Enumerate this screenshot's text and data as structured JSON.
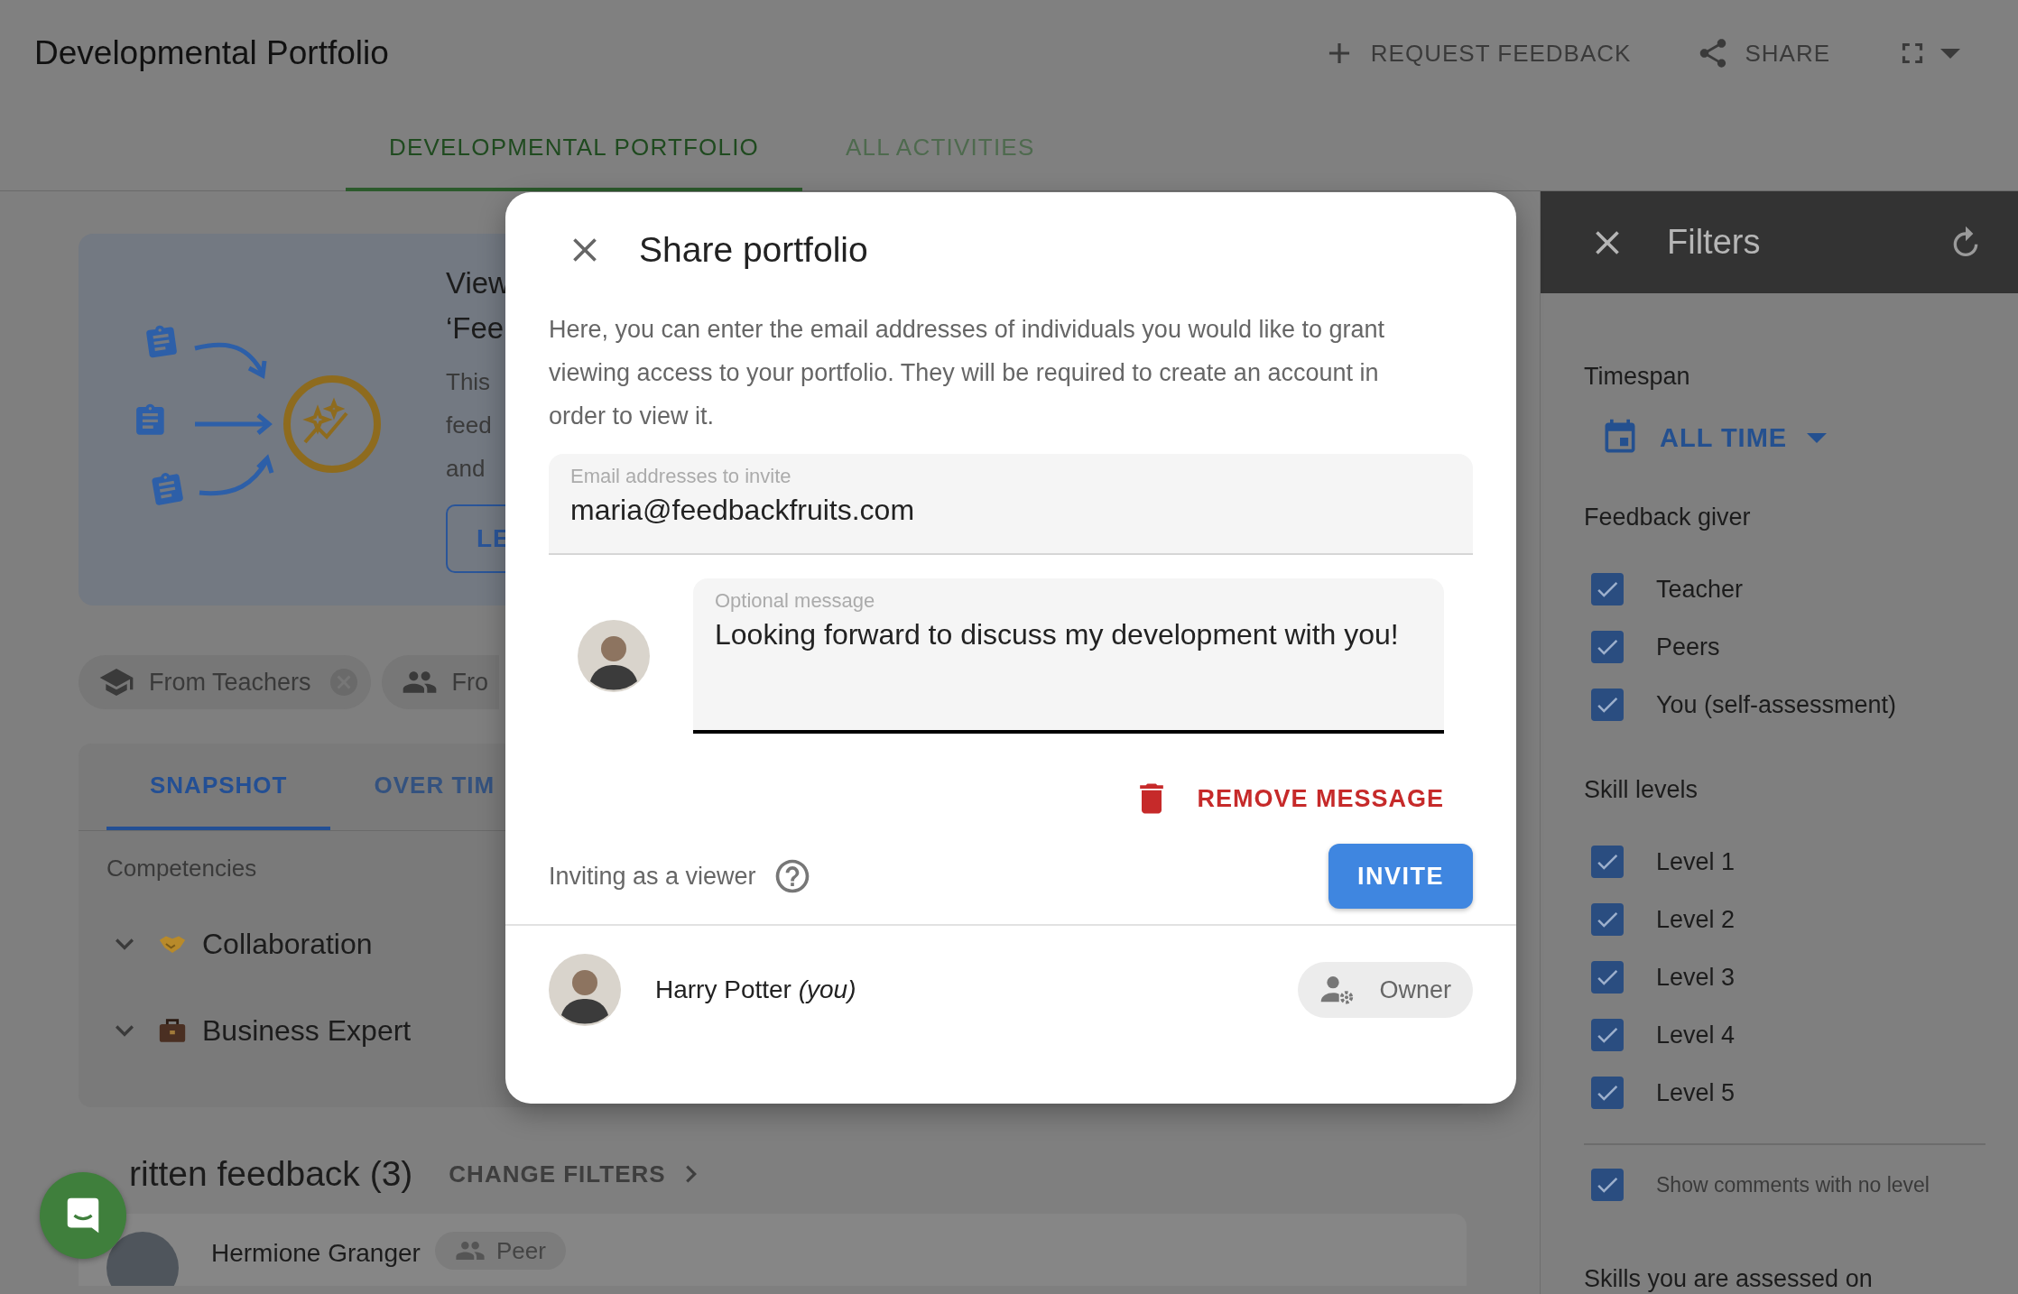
{
  "app_bar": {
    "title": "Developmental Portfolio",
    "actions": [
      {
        "kind": "add",
        "label": "REQUEST FEEDBACK"
      },
      {
        "kind": "share",
        "label": "SHARE"
      },
      {
        "kind": "fullscreen"
      }
    ]
  },
  "tabs": [
    {
      "label": "DEVELOPMENTAL PORTFOLIO",
      "selected": true
    },
    {
      "label": "ALL ACTIVITIES",
      "selected": false
    }
  ],
  "intro_card": {
    "heading_lines": [
      "View",
      "‘Fee"
    ],
    "body_lines": [
      "This",
      "feed",
      "and"
    ],
    "button": "LE"
  },
  "filter_chips": [
    {
      "kind": "teachers",
      "label": "From Teachers",
      "removable": true
    },
    {
      "kind": "people",
      "label": "Fro",
      "removable": false
    }
  ],
  "snapshot": {
    "tabs": [
      {
        "label": "SNAPSHOT",
        "selected": true
      },
      {
        "label": "OVER TIM",
        "selected": false
      }
    ],
    "heading": "Competencies",
    "rows": [
      {
        "kind": "handshake",
        "label": "Collaboration",
        "expanded": false
      },
      {
        "kind": "briefcase",
        "label": "Business Expert",
        "expanded": false
      }
    ]
  },
  "written_feedback": {
    "title": "ritten feedback (3)",
    "action": "CHANGE FILTERS",
    "items": [
      {
        "name": "Hermione Granger",
        "role": "Peer"
      }
    ]
  },
  "dialog": {
    "title": "Share portfolio",
    "description": "Here, you can enter the email addresses of individuals you would like to grant viewing access to your portfolio. They will be required to create an account in order to view it.",
    "email_field": {
      "label": "Email addresses to invite",
      "value": "maria@feedbackfruits.com"
    },
    "message_field": {
      "label": "Optional message",
      "value": "Looking forward to discuss my development with you!"
    },
    "remove_button": "REMOVE MESSAGE",
    "role_note": "Inviting as a viewer",
    "invite_button": "INVITE",
    "members": [
      {
        "name": "Harry Potter *(you)*",
        "role": "Owner"
      }
    ]
  },
  "filters": {
    "title": "Filters",
    "sections": [
      {
        "kind": "dropdown",
        "heading": "Timespan",
        "value": "ALL TIME"
      },
      {
        "kind": "checkboxes",
        "heading": "Feedback giver",
        "options": [
          {
            "label": "Teacher",
            "checked": true
          },
          {
            "label": "Peers",
            "checked": true
          },
          {
            "label": "You (self-assessment)",
            "checked": true
          }
        ]
      },
      {
        "kind": "checkboxes",
        "heading": "Skill levels",
        "options": [
          {
            "label": "Level 1",
            "checked": true
          },
          {
            "label": "Level 2",
            "checked": true
          },
          {
            "label": "Level 3",
            "checked": true
          },
          {
            "label": "Level 4",
            "checked": true
          },
          {
            "label": "Level 5",
            "checked": true
          }
        ]
      },
      {
        "kind": "minor",
        "options": [
          {
            "label": "Show comments with no level",
            "checked": true
          }
        ]
      },
      {
        "kind": "heading",
        "heading": "Skills you are assessed on"
      }
    ]
  }
}
